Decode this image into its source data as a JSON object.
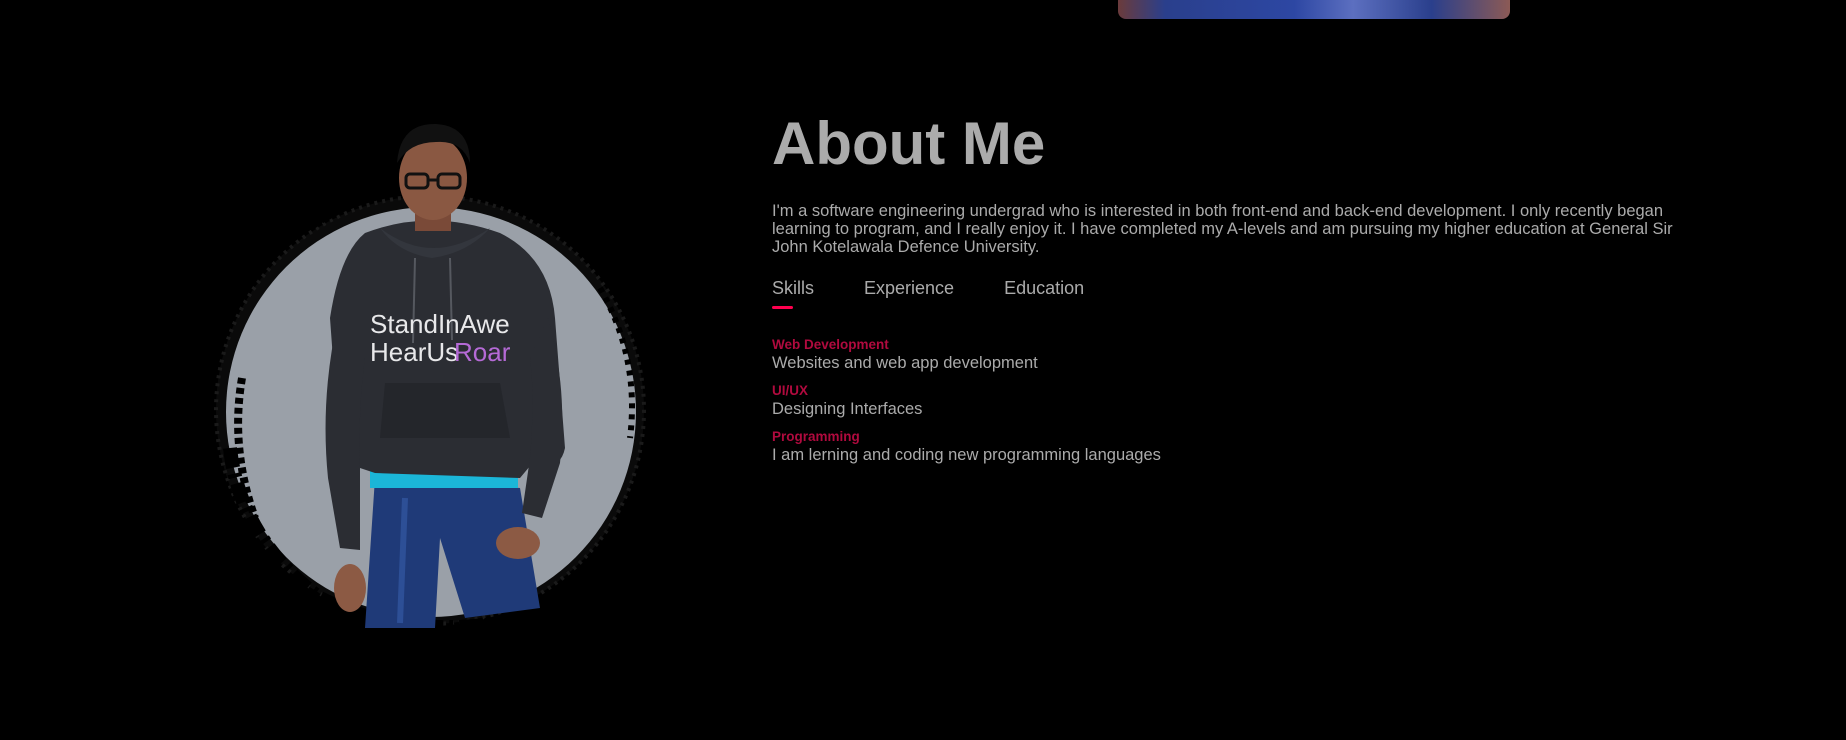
{
  "about": {
    "title": "About Me",
    "description": "I'm a software engineering undergrad who is interested in both front-end and back-end development. I only recently began learning to program, and I really enjoy it. I have completed my A-levels and am pursuing my higher education at General Sir John Kotelawala Defence University."
  },
  "tabs": [
    {
      "label": "Skills",
      "active": true
    },
    {
      "label": "Experience",
      "active": false
    },
    {
      "label": "Education",
      "active": false
    }
  ],
  "skills": [
    {
      "title": "Web Development",
      "description": "Websites and web app development"
    },
    {
      "title": "UI/UX",
      "description": "Designing Interfaces"
    },
    {
      "title": "Programming",
      "description": "I am lerning and coding new programming languages"
    }
  ],
  "profile_image": {
    "hoodie_text_line1": "StandInAwe",
    "hoodie_text_line2_a": "HearUs",
    "hoodie_text_line2_b": "Roar"
  },
  "colors": {
    "background": "#000000",
    "text": "#ababab",
    "accent": "#ff004f",
    "skill_title": "#b00a3e"
  }
}
